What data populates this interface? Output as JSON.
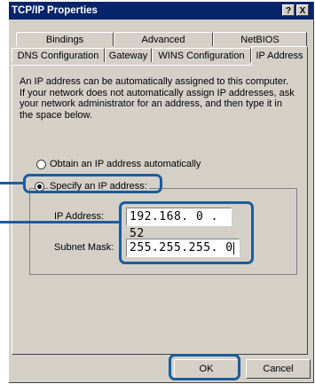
{
  "window": {
    "title": "TCP/IP Properties",
    "help_button": "?",
    "close_button": "X"
  },
  "tabs_back": [
    "Bindings",
    "Advanced",
    "NetBIOS"
  ],
  "tabs_front": [
    "DNS Configuration",
    "Gateway",
    "WINS Configuration",
    "IP Address"
  ],
  "active_tab": "IP Address",
  "description": "An IP address can be automatically assigned to this computer. If your network does not automatically assign IP addresses, ask your network administrator for an address, and then type it in the space below.",
  "options": {
    "obtain_label": "Obtain an IP address automatically",
    "specify_label": "Specify an IP address:",
    "selected": "specify"
  },
  "fields": {
    "ip_label": "IP Address:",
    "ip_value": "192.168. 0 . 52",
    "mask_label": "Subnet Mask:",
    "mask_value": "255.255.255. 0"
  },
  "buttons": {
    "ok": "OK",
    "cancel": "Cancel"
  },
  "colors": {
    "titlebar": "#08246b",
    "dialog_face": "#d4d0c8",
    "highlight": "#1a5d9c"
  }
}
